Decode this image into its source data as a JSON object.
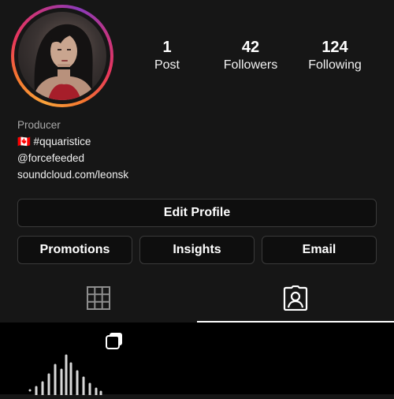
{
  "profile": {
    "category": "Producer",
    "bio_line1": "🇨🇦 #qquaristice",
    "bio_line2": "@forcefeeded",
    "link": "soundcloud.com/leonsk"
  },
  "stats": [
    {
      "value": "1",
      "label": "Post"
    },
    {
      "value": "42",
      "label": "Followers"
    },
    {
      "value": "124",
      "label": "Following"
    }
  ],
  "buttons": {
    "edit_profile": "Edit Profile",
    "promotions": "Promotions",
    "insights": "Insights",
    "email": "Email"
  },
  "tabs": [
    {
      "icon": "grid-icon",
      "active": false
    },
    {
      "icon": "tagged-icon",
      "active": true
    }
  ],
  "posts": [
    {
      "icon": "multiple-posts-icon",
      "thumbnail": "sound-wave"
    }
  ],
  "colors": {
    "background": "#161616",
    "button_bg": "#0e0e0e",
    "button_border": "#3a3a3a",
    "muted_text": "#a8a8a8",
    "ring_gradient": [
      "#f9a23b",
      "#e8365c",
      "#c13584",
      "#8a3ab9"
    ]
  }
}
